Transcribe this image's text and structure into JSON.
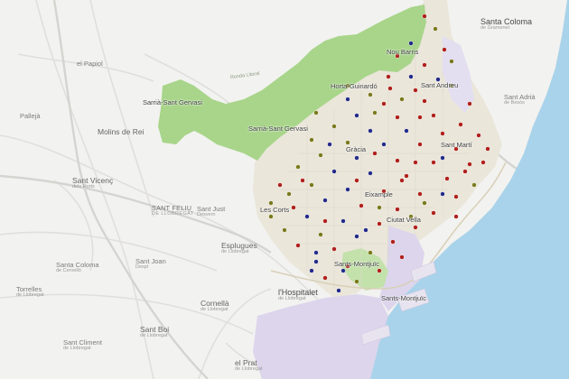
{
  "map": {
    "places": [
      {
        "id": "santa-coloma",
        "text": "Santa Coloma",
        "sub": "de Gramenet",
        "cls": "city"
      },
      {
        "id": "el-papiol",
        "text": "el Papiol",
        "sub": "",
        "cls": ""
      },
      {
        "id": "sarria-sant-gervasi",
        "text": "Sarrià-Sant Gervasi",
        "sub": "",
        "cls": "dist"
      },
      {
        "id": "sant-adria",
        "text": "Sant Adrià",
        "sub": "de Besòs",
        "cls": ""
      },
      {
        "id": "pallejà",
        "text": "Pallejà",
        "sub": "",
        "cls": ""
      },
      {
        "id": "molins-de-rei",
        "text": "Molins de Rei",
        "sub": "",
        "cls": "big"
      },
      {
        "id": "sant-vicenc",
        "text": "Sant Vicenç",
        "sub": "dels Horts",
        "cls": "big"
      },
      {
        "id": "sant-feliu",
        "text": "SANT FELIU",
        "sub": "DE LLOBREGAT",
        "cls": "caps"
      },
      {
        "id": "sant-just",
        "text": "Sant Just",
        "sub": "Desvern",
        "cls": ""
      },
      {
        "id": "esplugues",
        "text": "Esplugues",
        "sub": "de Llobregat",
        "cls": "big"
      },
      {
        "id": "santa-coloma-cervello",
        "text": "Santa Coloma",
        "sub": "de Cervelló",
        "cls": ""
      },
      {
        "id": "sant-joan",
        "text": "Sant Joan",
        "sub": "Despí",
        "cls": ""
      },
      {
        "id": "torrelles",
        "text": "Torrelles",
        "sub": "de Llobregat",
        "cls": ""
      },
      {
        "id": "cornella",
        "text": "Cornellà",
        "sub": "de Llobregat",
        "cls": "big"
      },
      {
        "id": "lhospitalet",
        "text": "l'Hospitalet",
        "sub": "de Llobregat",
        "cls": "city"
      },
      {
        "id": "sant-boi",
        "text": "Sant Boi",
        "sub": "de Llobregat",
        "cls": "big"
      },
      {
        "id": "sant-climent",
        "text": "Sant Climent",
        "sub": "de Llobregat",
        "cls": ""
      },
      {
        "id": "el-prat",
        "text": "el Prat",
        "sub": "de Llobregat",
        "cls": "big"
      }
    ],
    "districts": [
      {
        "id": "nou-barris",
        "text": "Nou Barris"
      },
      {
        "id": "horta-guinardo",
        "text": "Horta-Guinardó"
      },
      {
        "id": "sant-andreu",
        "text": "Sant Andreu"
      },
      {
        "id": "sarria-sant-gervasi-2",
        "text": "Sarrià-Sant Gervasi"
      },
      {
        "id": "sant-marti",
        "text": "Sant Martí"
      },
      {
        "id": "gracia",
        "text": "Gràcia"
      },
      {
        "id": "eixample",
        "text": "Eixample"
      },
      {
        "id": "les-corts",
        "text": "Les Corts"
      },
      {
        "id": "ciutat-vella",
        "text": "Ciutat Vella"
      },
      {
        "id": "sants-montjuic",
        "text": "Sants-Montjuïc"
      },
      {
        "id": "sants-montjuic-port",
        "text": "Sants-Montjuïc"
      }
    ],
    "road_labels": [
      {
        "id": "ronda-litoral",
        "text": "Ronda Litoral"
      }
    ],
    "colors": {
      "land": "#f2f2f0",
      "park": "#a8d58a",
      "sea": "#a9d3ea",
      "urban": "#eceae6",
      "industrial": "#dcd5ec",
      "dot_red": "#b0201c",
      "dot_blue": "#232b8a",
      "dot_olive": "#7a7a1c"
    },
    "marker_categories": [
      "red",
      "blue",
      "olive"
    ]
  }
}
